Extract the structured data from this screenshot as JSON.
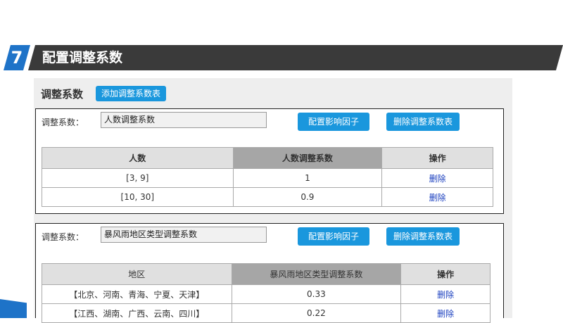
{
  "banner": {
    "number": "7",
    "title": "配置调整系数"
  },
  "panel": {
    "heading": "调整系数",
    "add_button": "添加调整系数表"
  },
  "factor_tables": [
    {
      "label": "调整系数：",
      "name_value": "人数调整系数",
      "config_button": "配置影响因子",
      "delete_table_button": "删除调整系数表",
      "columns": [
        "人数",
        "人数调整系数",
        "操作"
      ],
      "rows": [
        {
          "key": "[3, 9]",
          "value": "1",
          "action": "删除"
        },
        {
          "key": "[10, 30]",
          "value": "0.9",
          "action": "删除"
        }
      ]
    },
    {
      "label": "调整系数：",
      "name_value": "暴风雨地区类型调整系数",
      "config_button": "配置影响因子",
      "delete_table_button": "删除调整系数表",
      "columns": [
        "地区",
        "暴风雨地区类型调整系数",
        "操作"
      ],
      "rows": [
        {
          "key": "【北京、河南、青海、宁夏、天津】",
          "value": "0.33",
          "action": "删除"
        },
        {
          "key": "【江西、湖南、广西、云南、四川】",
          "value": "0.22",
          "action": "删除"
        }
      ]
    }
  ]
}
